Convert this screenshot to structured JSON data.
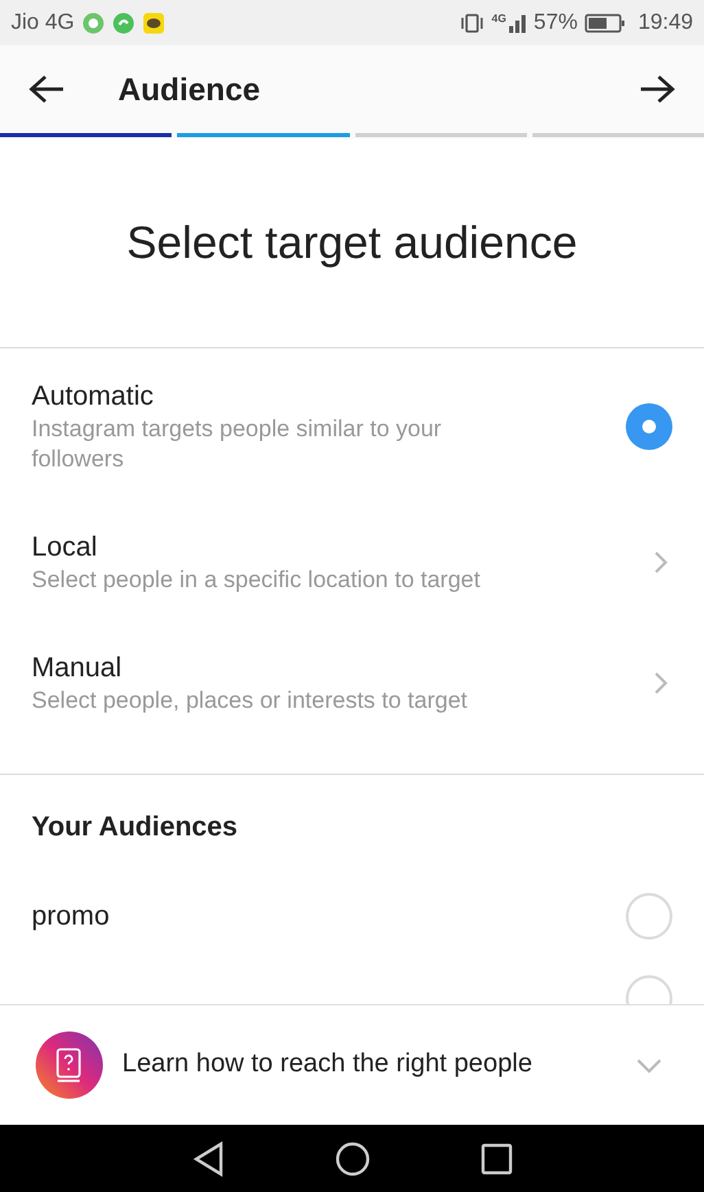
{
  "status_bar": {
    "carrier": "Jio 4G",
    "battery": "57%",
    "time": "19:49",
    "network": "4G"
  },
  "header": {
    "title": "Audience"
  },
  "progress": [
    {
      "done": true,
      "selected": false
    },
    {
      "done": false,
      "selected": true
    },
    {
      "done": false,
      "selected": false
    },
    {
      "done": false,
      "selected": false
    }
  ],
  "heading": "Select target audience",
  "options": [
    {
      "kind": "radio",
      "title": "Automatic",
      "description": "Instagram targets people similar to your followers",
      "selected": true
    },
    {
      "kind": "link",
      "title": "Local",
      "description": "Select people in a specific location to target"
    },
    {
      "kind": "link",
      "title": "Manual",
      "description": "Select people, places or interests to target"
    }
  ],
  "your_audiences": {
    "title": "Your Audiences",
    "items": [
      {
        "name": "promo",
        "selected": false
      },
      {
        "selected": false
      }
    ]
  },
  "banner": {
    "text": "Learn how to reach the right people",
    "expanded": false
  }
}
